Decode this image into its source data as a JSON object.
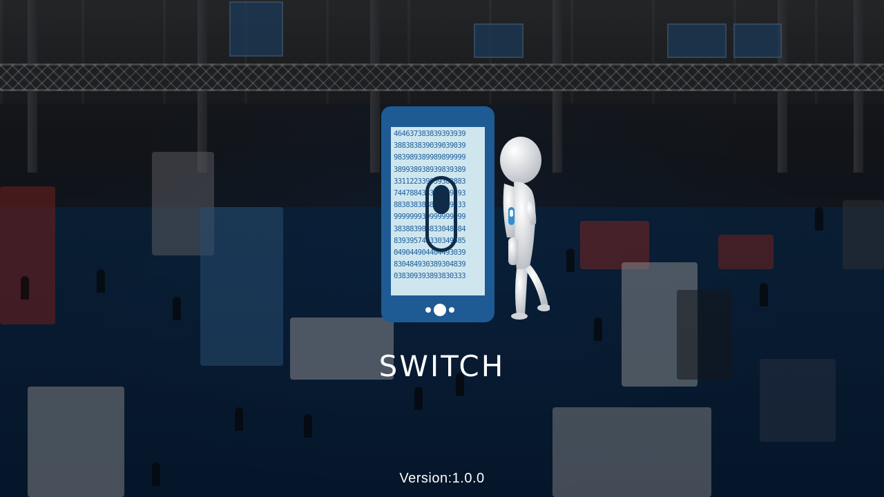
{
  "splash": {
    "app_name": "SWITCH",
    "version": "Version:1.0.0"
  },
  "logo": {
    "phone_digits": [
      "464637383839393939",
      "388383839039039039",
      "983989389989899999",
      "389938938939839389",
      "331122339939383883",
      "744788433343399393",
      "883838388839339933",
      "999999939999999999",
      "383883983833048484",
      "839395748330349585",
      "049044904404493039",
      "830484930389304839",
      "038309393893830333"
    ],
    "icons": [
      "smartphone-icon",
      "toggle-switch-icon",
      "white-figure-illustration"
    ],
    "colors": {
      "phone_body": "#1e5a93",
      "phone_screen": "#cfe6ef",
      "digits": "#1f5f9a",
      "toggle": "#0f2b47"
    }
  },
  "background": {
    "description_icon": "exhibition-hall-photo"
  }
}
